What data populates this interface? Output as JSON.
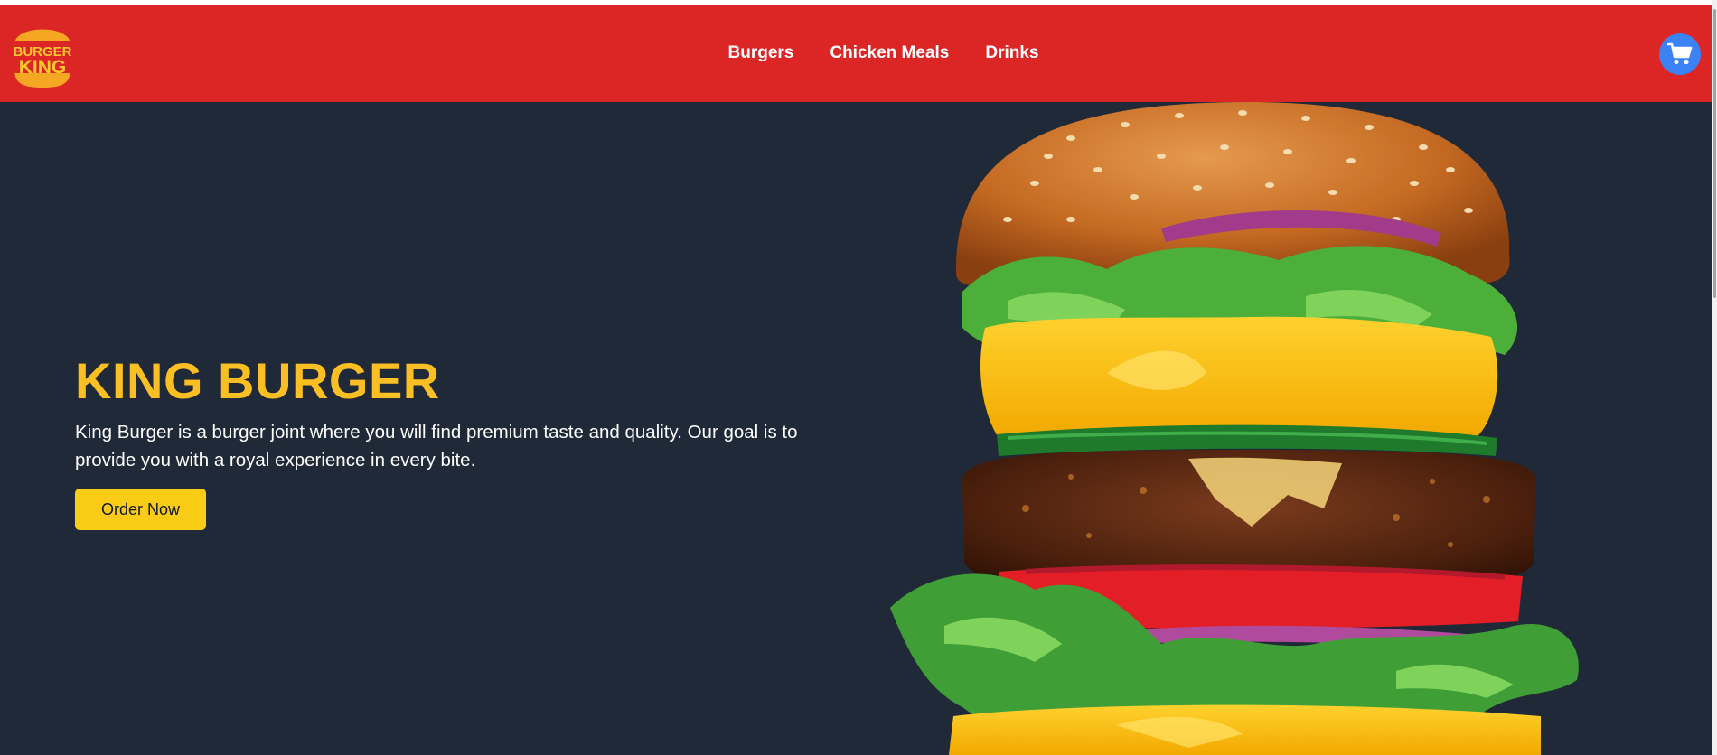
{
  "brand": {
    "logo_line1": "BURGER",
    "logo_line2": "KING",
    "logo_color": "#ffc72c",
    "logo_bun_color": "#f5a623"
  },
  "nav": {
    "links": [
      {
        "label": "Burgers"
      },
      {
        "label": "Chicken Meals"
      },
      {
        "label": "Drinks"
      }
    ],
    "cart_icon": "cart-icon",
    "background": "#dc2626",
    "cart_color": "#3b82f6"
  },
  "hero": {
    "title": "KING BURGER",
    "description": "King Burger is a burger joint where you will find premium taste and quality. Our goal is to provide you with a royal experience in every bite.",
    "cta_label": "Order Now",
    "background": "#1f2937",
    "title_color": "#fbbf24",
    "cta_color": "#facc15",
    "image": "burger-image"
  }
}
